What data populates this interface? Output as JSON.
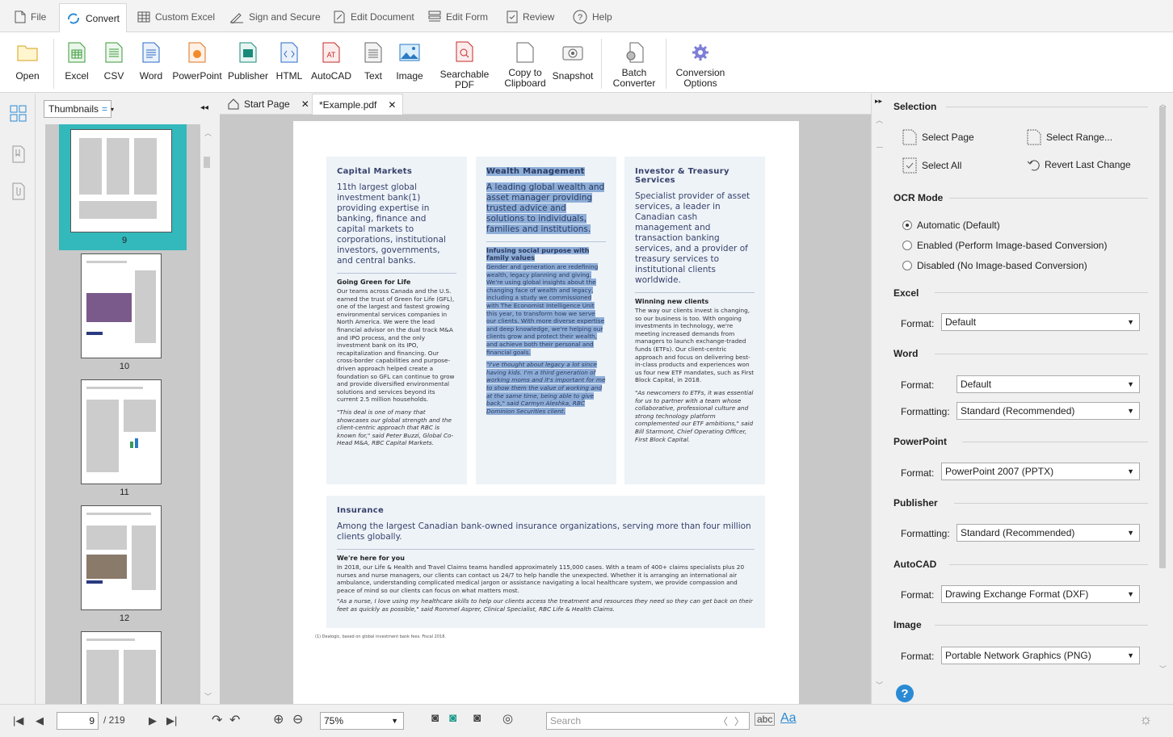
{
  "menu": {
    "items": [
      "File",
      "Convert",
      "Custom Excel",
      "Sign and Secure",
      "Edit Document",
      "Edit Form",
      "Review",
      "Help"
    ],
    "active": "Convert"
  },
  "ribbon": {
    "open": "Open",
    "excel": "Excel",
    "csv": "CSV",
    "word": "Word",
    "powerpoint": "PowerPoint",
    "publisher": "Publisher",
    "html": "HTML",
    "autocad": "AutoCAD",
    "text": "Text",
    "image": "Image",
    "searchable": "Searchable PDF",
    "copy": "Copy to\nClipboard",
    "snapshot": "Snapshot",
    "batch": "Batch\nConverter",
    "options": "Conversion\nOptions"
  },
  "thumbs": {
    "dropdown": "Thumbnails",
    "pages": [
      "9",
      "10",
      "11",
      "12"
    ]
  },
  "doctabs": {
    "start": "Start Page",
    "doc": "*Example.pdf"
  },
  "doc": {
    "c1": {
      "title": "Capital Markets",
      "lead": "11th largest global investment bank(1) providing expertise in banking, finance and capital markets to corporations, institutional investors, governments, and central banks.",
      "sub": "Going Green for Life",
      "body": "Our teams across Canada and the U.S. earned the trust of Green for Life (GFL), one of the largest and fastest growing environmental services companies in North America. We were the lead financial advisor on the dual track M&A and IPO process, and the only investment bank on its IPO, recapitalization and financing. Our cross-border capabilities and purpose-driven approach helped create a foundation so GFL can continue to grow and provide diversified environmental solutions and services beyond its current 2.5 million households.",
      "quote": "\"This deal is one of many that showcases our global strength and the client-centric approach that RBC is known for,\" said Peter Buzzi, Global Co-Head M&A, RBC Capital Markets."
    },
    "c2": {
      "title": "Wealth Management",
      "lead": "A leading global wealth and asset manager providing trusted advice and solutions to individuals, families and institutions.",
      "sub": "Infusing social purpose with family values",
      "body": "Gender and generation are redefining wealth, legacy planning and giving. We're using global insights about the changing face of wealth and legacy, including a study we commissioned with The Economist Intelligence Unit this year, to transform how we serve our clients. With more diverse expertise and deep knowledge, we're helping our clients grow and protect their wealth, and achieve both their personal and financial goals.",
      "quote": "\"I've thought about legacy a lot since having kids. I'm a third generation of working moms and it's important for me to show them the value of working and at the same time, being able to give back,\" said Carmyn Aleshka, RBC Dominion Securities client."
    },
    "c3": {
      "title": "Investor & Treasury Services",
      "lead": "Specialist provider of asset services, a leader in Canadian cash management and transaction banking services, and a provider of treasury services to institutional clients worldwide.",
      "sub": "Winning new clients",
      "body": "The way our clients invest is changing, so our business is too. With ongoing investments in technology, we're meeting increased demands from managers to launch exchange-traded funds (ETFs). Our client-centric approach and focus on delivering best-in-class products and experiences won us four new ETF mandates, such as First Block Capital, in 2018.",
      "quote": "\"As newcomers to ETFs, it was essential for us to partner with a team whose collaborative, professional culture and strong technology platform complemented our ETF ambitions,\" said Bill Starmont, Chief Operating Officer, First Block Capital."
    },
    "c4": {
      "title": "Insurance",
      "lead": "Among the largest Canadian bank-owned insurance organizations, serving more than four million clients globally.",
      "sub": "We're here for you",
      "body": "In 2018, our Life & Health and Travel Claims teams handled approximately 115,000 cases. With a team of 400+ claims specialists plus 20 nurses and nurse managers, our clients can contact us 24/7 to help handle the unexpected. Whether it is arranging an international air ambulance, understanding complicated medical jargon or assistance navigating a local healthcare system, we provide compassion and peace of mind so our clients can focus on what matters most.",
      "quote": "\"As a nurse, I love using my healthcare skills to help our clients access the treatment and resources they need so they can get back on their feet as quickly as possible,\" said Rommel Asprer, Clinical Specialist, RBC Life & Health Claims."
    },
    "footnote": "(1)  Dealogic, based on global investment bank fees. Fiscal 2018."
  },
  "right": {
    "selection": "Selection",
    "select_page": "Select Page",
    "select_range": "Select Range...",
    "select_all": "Select All",
    "revert": "Revert Last Change",
    "ocr": "OCR Mode",
    "ocr_auto": "Automatic (Default)",
    "ocr_enabled": "Enabled (Perform Image-based Conversion)",
    "ocr_disabled": "Disabled (No Image-based Conversion)",
    "excel": "Excel",
    "word": "Word",
    "powerpoint": "PowerPoint",
    "publisher": "Publisher",
    "autocad": "AutoCAD",
    "image": "Image",
    "format_label": "Format:",
    "formatting_label": "Formatting:",
    "excel_format": "Default",
    "word_format": "Default",
    "word_formatting": "Standard (Recommended)",
    "ppt_format": "PowerPoint 2007 (PPTX)",
    "pub_formatting": "Standard (Recommended)",
    "autocad_format": "Drawing Exchange Format (DXF)",
    "image_format": "Portable Network Graphics (PNG)"
  },
  "status": {
    "page": "9",
    "total": "/ 219",
    "zoom": "75%",
    "search_placeholder": "Search",
    "abc": "abc",
    "aa": "Aa"
  }
}
